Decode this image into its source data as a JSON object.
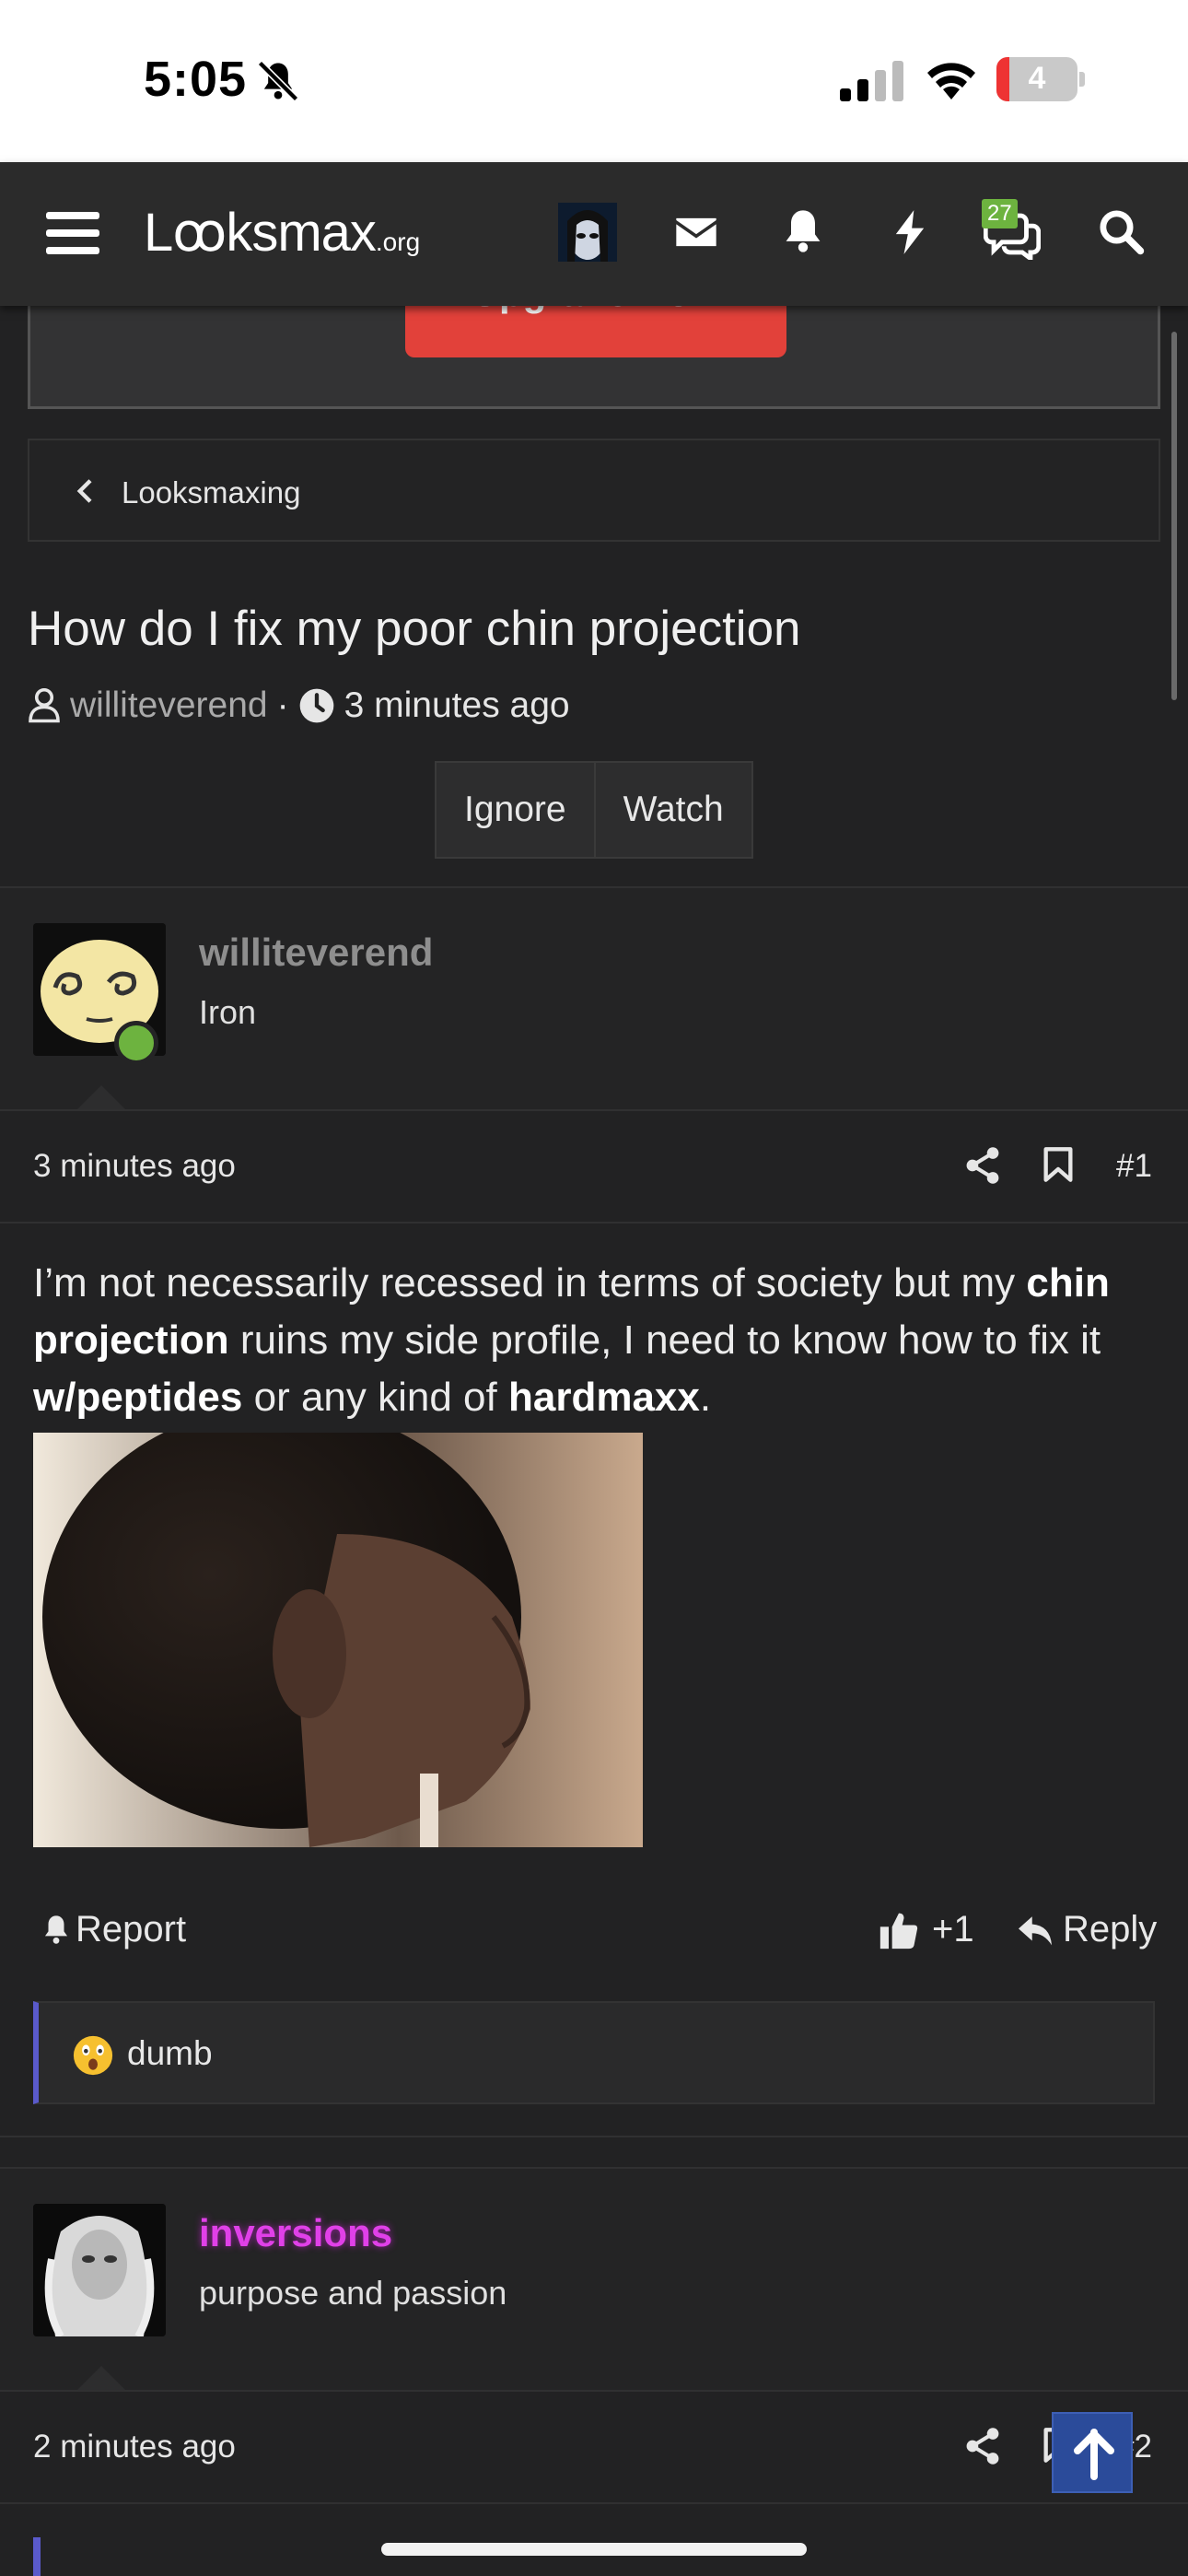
{
  "status_bar": {
    "time": "5:05",
    "battery": "4"
  },
  "nav": {
    "logo_main": "Lꝏksmax",
    "logo_suffix": ".org",
    "messages_badge": "27",
    "icons": [
      "menu-icon",
      "avatar",
      "mail-icon",
      "bell-icon",
      "bolt-icon",
      "conversations-icon",
      "search-icon"
    ]
  },
  "banner": {
    "upgrade_label": "Upgrade Now"
  },
  "breadcrumb": {
    "label": "Looksmaxing"
  },
  "thread": {
    "title": "How do I fix my poor chin projection",
    "author": "williteverend",
    "separator": "·",
    "time": "3 minutes ago",
    "buttons": {
      "ignore": "Ignore",
      "watch": "Watch"
    }
  },
  "posts": [
    {
      "username": "williteverend",
      "user_title": "Iron",
      "date": "3 minutes ago",
      "number": "#1",
      "body": {
        "t1": "I’m not necessarily recessed in terms of society but my ",
        "b1": "chin projection",
        "t2": " ruins my side profile, I need to know how to fix it ",
        "b2": "w/peptides",
        "t3": " or any kind of ",
        "b3": "hardmaxx",
        "t4": "."
      },
      "actions": {
        "report": "Report",
        "like_count": "+1",
        "reply": "Reply"
      },
      "reaction": {
        "emoji": "astonished-face",
        "text": "dumb"
      }
    },
    {
      "username": "inversions",
      "user_title": "purpose and passion",
      "date": "2 minutes ago",
      "number": "#2"
    }
  ],
  "colors": {
    "background": "#222223",
    "navbar": "#2b2b2b",
    "upgrade_button": "#e2413a",
    "online_dot": "#6db33f",
    "inversions_name": "#e040e8",
    "reaction_border": "#5a5acb",
    "to_top": "#2b4b9a"
  }
}
